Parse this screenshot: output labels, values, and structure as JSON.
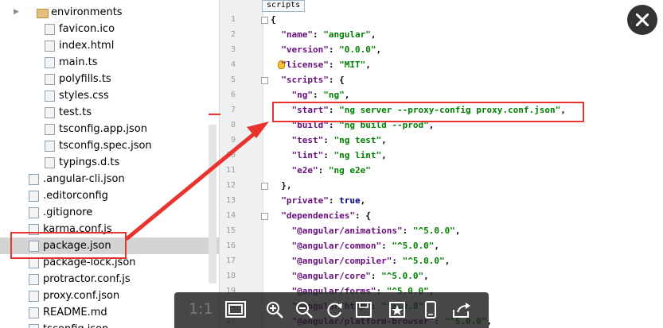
{
  "tree": {
    "items": [
      {
        "label": "environments",
        "kind": "folder",
        "indent": 3,
        "arrow": "▶"
      },
      {
        "label": "favicon.ico",
        "kind": "ico",
        "indent": 4
      },
      {
        "label": "index.html",
        "kind": "html",
        "indent": 4
      },
      {
        "label": "main.ts",
        "kind": "ts",
        "indent": 4
      },
      {
        "label": "polyfills.ts",
        "kind": "ts",
        "indent": 4
      },
      {
        "label": "styles.css",
        "kind": "css",
        "indent": 4
      },
      {
        "label": "test.ts",
        "kind": "ts",
        "indent": 4
      },
      {
        "label": "tsconfig.app.json",
        "kind": "json",
        "indent": 4
      },
      {
        "label": "tsconfig.spec.json",
        "kind": "json",
        "indent": 4
      },
      {
        "label": "typings.d.ts",
        "kind": "ts",
        "indent": 4
      },
      {
        "label": ".angular-cli.json",
        "kind": "json",
        "indent": 2
      },
      {
        "label": ".editorconfig",
        "kind": "txt",
        "indent": 2
      },
      {
        "label": ".gitignore",
        "kind": "txt",
        "indent": 2
      },
      {
        "label": "karma.conf.js",
        "kind": "js",
        "indent": 2
      },
      {
        "label": "package.json",
        "kind": "json",
        "indent": 2,
        "selected": true
      },
      {
        "label": "package-lock.json",
        "kind": "json",
        "indent": 2
      },
      {
        "label": "protractor.conf.js",
        "kind": "js",
        "indent": 2
      },
      {
        "label": "proxy.conf.json",
        "kind": "json",
        "indent": 2
      },
      {
        "label": "README.md",
        "kind": "md",
        "indent": 2
      },
      {
        "label": "tsconfig.json",
        "kind": "json",
        "indent": 2
      }
    ]
  },
  "editor": {
    "breadcrumb": "scripts",
    "lines": [
      {
        "n": "1",
        "html": "{"
      },
      {
        "n": "2",
        "html": "  <span class='k'>\"name\"</span>: <span class='s'>\"angular\"</span>,"
      },
      {
        "n": "3",
        "html": "  <span class='k'>\"version\"</span>: <span class='s'>\"0.0.0\"</span>,"
      },
      {
        "n": "4",
        "html": "  <span class='k'>\"license\"</span>: <span class='s'>\"MIT\"</span>,"
      },
      {
        "n": "5",
        "html": "  <span class='k'>\"scripts\"</span>: {"
      },
      {
        "n": "6",
        "html": "    <span class='k'>\"ng\"</span>: <span class='s'>\"ng\"</span>,"
      },
      {
        "n": "7",
        "html": "    <span class='k'>\"start\"</span>: <span class='s'>\"ng server --proxy-config proxy.conf.json\"</span>,"
      },
      {
        "n": "8",
        "html": "    <span class='k'>\"build\"</span>: <span class='s'>\"ng build --prod\"</span>,"
      },
      {
        "n": "9",
        "html": "    <span class='k'>\"test\"</span>: <span class='s'>\"ng test\"</span>,"
      },
      {
        "n": "10",
        "html": "    <span class='k'>\"lint\"</span>: <span class='s'>\"ng lint\"</span>,"
      },
      {
        "n": "11",
        "html": "    <span class='k'>\"e2e\"</span>: <span class='s'>\"ng e2e\"</span>"
      },
      {
        "n": "12",
        "html": "  },"
      },
      {
        "n": "13",
        "html": "  <span class='k'>\"private\"</span>: <span class='kw'>true</span>,"
      },
      {
        "n": "14",
        "html": "  <span class='k'>\"dependencies\"</span>: {"
      },
      {
        "n": "15",
        "html": "    <span class='k'>\"@angular/animations\"</span>: <span class='s'>\"^5.0.0\"</span>,"
      },
      {
        "n": "16",
        "html": "    <span class='k'>\"@angular/common\"</span>: <span class='s'>\"^5.0.0\"</span>,"
      },
      {
        "n": "17",
        "html": "    <span class='k'>\"@angular/compiler\"</span>: <span class='s'>\"^5.0.0\"</span>,"
      },
      {
        "n": "18",
        "html": "    <span class='k'>\"@angular/core\"</span>: <span class='s'>\"^5.0.0\"</span>,"
      },
      {
        "n": "19",
        "html": "    <span class='k'>\"@angular/forms\"</span>: <span class='s'>\"^5.0.0\"</span>,"
      },
      {
        "n": "20",
        "html": "    <span class='k'>\"@angular/http\"</span>: <span class='s'>\"^5.0.0\"</span>,"
      },
      {
        "n": "21",
        "html": "    <span class='k'>\"@angular/platform-browser\"</span>: <span class='s'>\"^5.0.0\"</span>,"
      }
    ]
  },
  "viewer": {
    "ratio_label": "1:1",
    "buttons": [
      "fit-screen",
      "zoom-in",
      "zoom-out",
      "rotate",
      "save",
      "bookmark",
      "device",
      "share"
    ]
  },
  "colors": {
    "annotation_red": "#e8332e",
    "json_key": "#660e7a",
    "json_string": "#008000"
  }
}
